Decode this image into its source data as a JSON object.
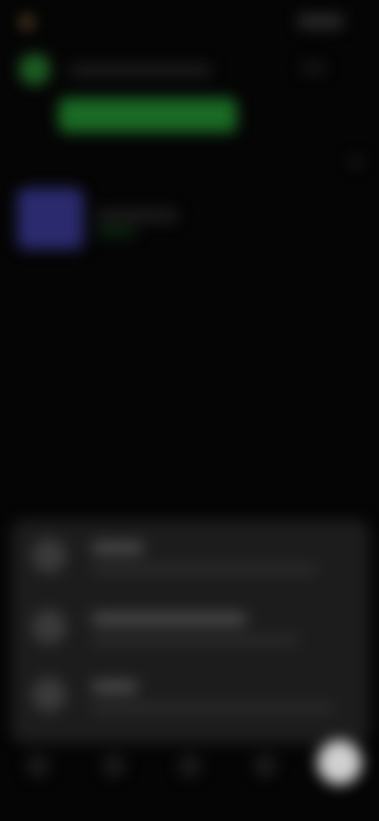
{
  "header": {
    "back_label": "",
    "right_label": ""
  },
  "profile": {
    "name": "",
    "meta": ""
  },
  "green_button": {
    "label": ""
  },
  "media": {
    "title": "",
    "subtitle": ""
  },
  "sheet": {
    "items": [
      {
        "title": "",
        "subtitle": ""
      },
      {
        "title": "",
        "subtitle": ""
      },
      {
        "title": "",
        "subtitle": ""
      }
    ]
  },
  "nav": {
    "icons": [
      "home-icon",
      "search-icon",
      "library-icon",
      "profile-icon"
    ],
    "fab_icon": "add-icon"
  },
  "colors": {
    "background": "#050505",
    "accent_green": "#1a6a24",
    "thumb_purple": "#2b2a6e",
    "sheet_bg": "#1c1c1c",
    "fab": "#d0d0d0"
  }
}
